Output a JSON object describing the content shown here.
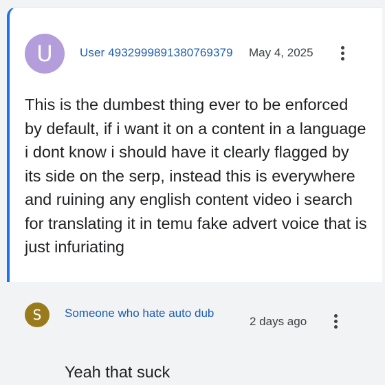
{
  "post": {
    "avatar_letter": "U",
    "avatar_color": "#b39ddb",
    "author": "User 4932999891380769379",
    "date": "May 4, 2025",
    "body": "This is the dumbest thing ever to be enforced by default, if i want it on a content in a language i dont know i should have it clearly flagged by its side on the serp, instead this is everywhere and ruining any english content video i search for translating it in temu fake advert voice that is just infuriating",
    "accent_color": "#1a73e8"
  },
  "reply": {
    "avatar_letter": "S",
    "avatar_color": "#9a7b1c",
    "author": "Someone who hate auto dub",
    "date": "2 days ago",
    "body": "Yeah that suck"
  },
  "icons": {
    "more": "more-vert-icon"
  }
}
